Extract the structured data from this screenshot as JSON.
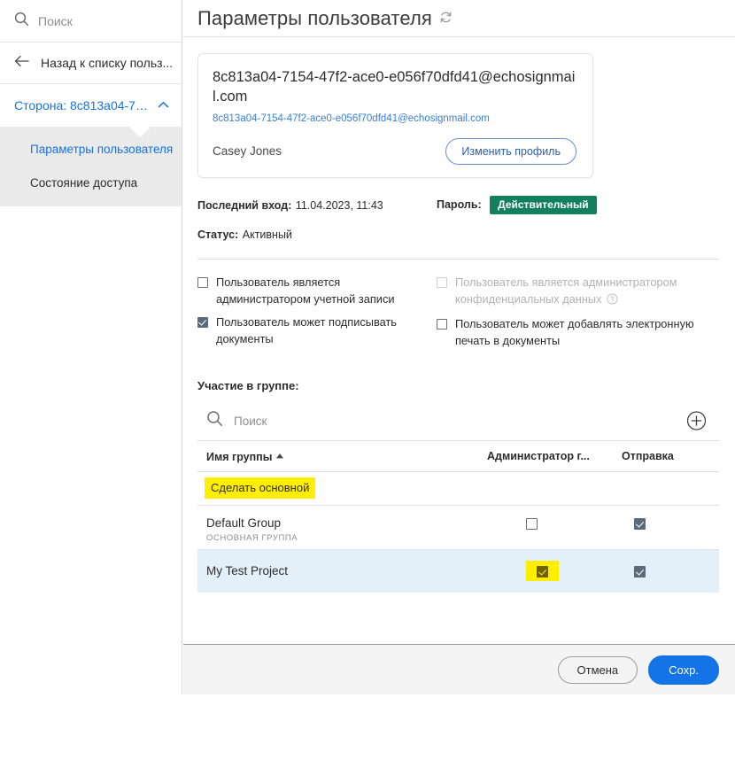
{
  "sidebar": {
    "search": {
      "placeholder": "Поиск",
      "icon": "search-icon"
    },
    "back": {
      "label": "Назад к списку польз...",
      "icon": "arrow-left-icon"
    },
    "party": {
      "label": "Сторона: 8c813a04-715...",
      "icon": "chevron-up-icon"
    },
    "submenu": [
      {
        "label": "Параметры пользователя",
        "active": true
      },
      {
        "label": "Состояние доступа",
        "active": false
      }
    ]
  },
  "header": {
    "title": "Параметры пользователя",
    "refresh_icon": "refresh-icon"
  },
  "profile": {
    "uid": "8c813a04-7154-47f2-ace0-e056f70dfd41@echosignmail.com",
    "email_link": "8c813a04-7154-47f2-ace0-e056f70dfd41@echosignmail.com",
    "name": "Casey Jones",
    "edit_button": "Изменить профиль"
  },
  "meta": {
    "last_login_label": "Последний вход:",
    "last_login_value": "11.04.2023, 11:43",
    "password_label": "Пароль:",
    "password_badge": "Действительный",
    "password_badge_color": "#12805c",
    "status_label": "Статус:",
    "status_value": "Активный"
  },
  "permissions": {
    "left": [
      {
        "label": "Пользователь является администратором учетной записи",
        "checked": false,
        "disabled": false
      },
      {
        "label": "Пользователь может подписывать документы",
        "checked": true,
        "disabled": false
      }
    ],
    "right": [
      {
        "label": "Пользователь является администратором конфиденциальных данных",
        "checked": false,
        "disabled": true,
        "help_icon": "question-mark-icon"
      },
      {
        "label": "Пользователь может добавлять электронную печать в документы",
        "checked": false,
        "disabled": false
      }
    ]
  },
  "groups": {
    "section_title": "Участие в группе:",
    "search_placeholder": "Поиск",
    "search_icon": "search-icon",
    "add_icon": "plus-circle-icon",
    "columns": [
      "Имя группы",
      "Администратор г...",
      "Отправка"
    ],
    "sort_indicator": "▲",
    "context_action": {
      "label": "Сделать основной",
      "highlight_color": "#ffee00"
    },
    "rows": [
      {
        "name": "Default Group",
        "subtitle": "ОСНОВНАЯ ГРУППА",
        "admin_checked": false,
        "admin_highlighted": false,
        "send_checked": true,
        "selected": false
      },
      {
        "name": "My Test Project",
        "subtitle": "",
        "admin_checked": true,
        "admin_highlighted": true,
        "send_checked": true,
        "selected": true
      }
    ]
  },
  "footer": {
    "cancel": "Отмена",
    "save": "Сохр.",
    "save_color": "#1473e6"
  }
}
